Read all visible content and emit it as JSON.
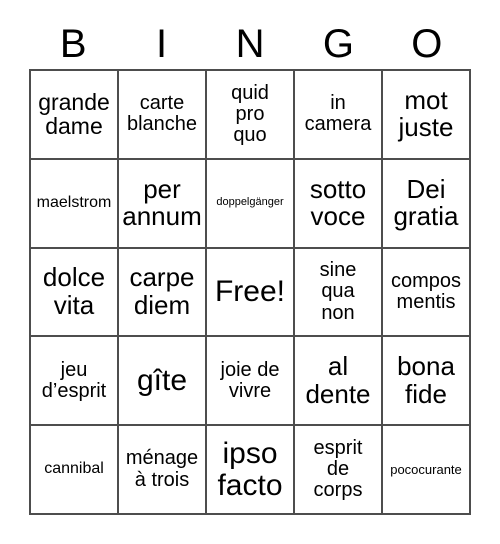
{
  "card": {
    "header_letters": [
      "B",
      "I",
      "N",
      "G",
      "O"
    ],
    "grid": {
      "rows": 5,
      "columns": 5,
      "border_color": "#4d4d4d",
      "background_color": "#ffffff",
      "text_color": "#000000"
    },
    "cells": [
      {
        "text": "grande\ndame",
        "size": "lg"
      },
      {
        "text": "carte\nblanche",
        "size": "md"
      },
      {
        "text": "quid\npro\nquo",
        "size": "md"
      },
      {
        "text": "in\ncamera",
        "size": "md"
      },
      {
        "text": "mot\njuste",
        "size": "xl"
      },
      {
        "text": "maelstrom",
        "size": "sm"
      },
      {
        "text": "per\nannum",
        "size": "xl"
      },
      {
        "text": "doppelgänger",
        "size": "xxs"
      },
      {
        "text": "sotto\nvoce",
        "size": "xl"
      },
      {
        "text": "Dei\ngratia",
        "size": "xl"
      },
      {
        "text": "dolce\nvita",
        "size": "xl"
      },
      {
        "text": "carpe\ndiem",
        "size": "xl"
      },
      {
        "text": "Free!",
        "size": "xxl"
      },
      {
        "text": "sine\nqua\nnon",
        "size": "md"
      },
      {
        "text": "compos\nmentis",
        "size": "md"
      },
      {
        "text": "jeu\nd’esprit",
        "size": "md"
      },
      {
        "text": "gîte",
        "size": "xxl"
      },
      {
        "text": "joie de\nvivre",
        "size": "md"
      },
      {
        "text": "al\ndente",
        "size": "xl"
      },
      {
        "text": "bona\nfide",
        "size": "xl"
      },
      {
        "text": "cannibal",
        "size": "sm"
      },
      {
        "text": "ménage\nà trois",
        "size": "md"
      },
      {
        "text": "ipso\nfacto",
        "size": "xxl"
      },
      {
        "text": "esprit\nde\ncorps",
        "size": "md"
      },
      {
        "text": "pococurante",
        "size": "xs"
      }
    ]
  }
}
